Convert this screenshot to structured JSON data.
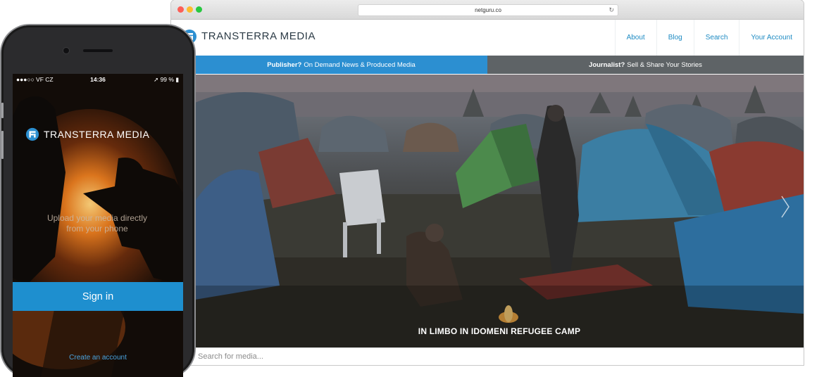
{
  "browser": {
    "url": "netguru.co"
  },
  "site": {
    "brand": "TRANSTERRA MEDIA",
    "nav": [
      "About",
      "Blog",
      "Search",
      "Your Account"
    ],
    "banner_left": {
      "bold": "Publisher?",
      "text": "On Demand News & Produced Media"
    },
    "banner_right": {
      "bold": "Journalist?",
      "text": "Sell & Share Your Stories"
    },
    "hero_caption": "IN LIMBO IN IDOMENI REFUGEE CAMP",
    "search_placeholder": "Search for media..."
  },
  "phone": {
    "status": {
      "carrier": "●●●○○ VF CZ",
      "time": "14:36",
      "battery": "99 %"
    },
    "brand": "TRANSTERRA MEDIA",
    "tagline": "Upload your media directly from your phone",
    "signin_label": "Sign in",
    "create_account_label": "Create an account"
  },
  "colors": {
    "accent_blue": "#2c8fd1",
    "banner_gray": "#5e6366",
    "signin_blue": "#1e8fcf",
    "nav_link": "#1e8bc3"
  }
}
